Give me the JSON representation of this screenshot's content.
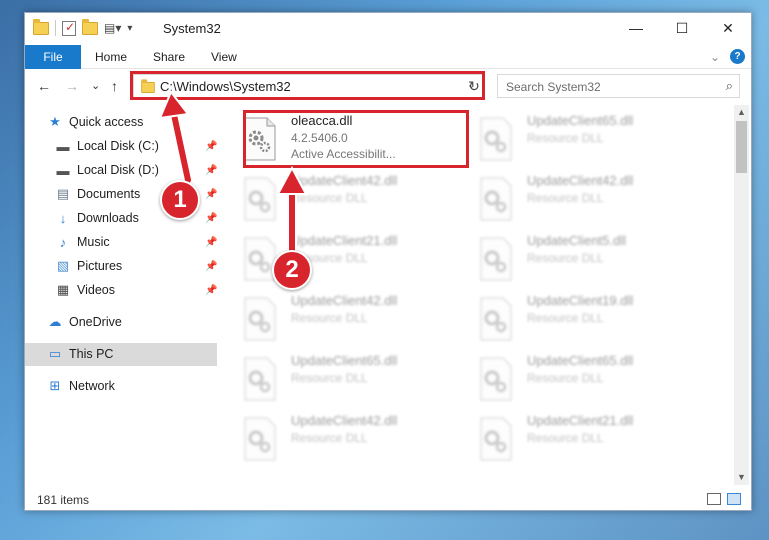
{
  "window": {
    "title": "System32",
    "controls": {
      "minimize": "—",
      "maximize": "☐",
      "close": "✕"
    }
  },
  "ribbon": {
    "tabs": [
      "File",
      "Home",
      "Share",
      "View"
    ],
    "collapse_glyph": "⌄",
    "help_glyph": "?"
  },
  "nav": {
    "back": "←",
    "forward": "→",
    "recent": "⌄",
    "up": "↑"
  },
  "address": {
    "path": "C:\\Windows\\System32",
    "dropdown": "⌄",
    "refresh": "↻"
  },
  "search": {
    "placeholder": "Search System32",
    "icon": "⌕"
  },
  "sidebar": {
    "items": [
      {
        "label": "Quick access",
        "icon": "★",
        "color": "#2d7fd3",
        "pinned": false
      },
      {
        "label": "Local Disk (C:)",
        "icon": "▬",
        "color": "#555555",
        "pinned": true
      },
      {
        "label": "Local Disk (D:)",
        "icon": "▬",
        "color": "#555555",
        "pinned": true
      },
      {
        "label": "Documents",
        "icon": "▤",
        "color": "#6a7a8a",
        "pinned": true
      },
      {
        "label": "Downloads",
        "icon": "↓",
        "color": "#2d7fd3",
        "pinned": true
      },
      {
        "label": "Music",
        "icon": "♪",
        "color": "#2d7fd3",
        "pinned": true
      },
      {
        "label": "Pictures",
        "icon": "▧",
        "color": "#4a8fcf",
        "pinned": true
      },
      {
        "label": "Videos",
        "icon": "▦",
        "color": "#444444",
        "pinned": true
      },
      {
        "label": "OneDrive",
        "icon": "☁",
        "color": "#2d7fd3",
        "pinned": false
      },
      {
        "label": "This PC",
        "icon": "▭",
        "color": "#2d7fd3",
        "pinned": false
      },
      {
        "label": "Network",
        "icon": "⊞",
        "color": "#2d7fd3",
        "pinned": false
      }
    ],
    "pin_glyph": "📌"
  },
  "files": [
    {
      "name": "oleacca.dll",
      "version": "4.2.5406.0",
      "description": "Active Accessibilit...",
      "highlighted": true
    },
    {
      "name": "UpdateClient65.dll",
      "type": "Resource DLL"
    },
    {
      "name": "UpdateClient42.dll",
      "type": "Resource DLL"
    },
    {
      "name": "UpdateClient42.dll",
      "type": "Resource DLL"
    },
    {
      "name": "UpdateClient21.dll",
      "type": "Resource DLL"
    },
    {
      "name": "UpdateClient5.dll",
      "type": "Resource DLL"
    },
    {
      "name": "UpdateClient42.dll",
      "type": "Resource DLL"
    },
    {
      "name": "UpdateClient19.dll",
      "type": "Resource DLL"
    },
    {
      "name": "UpdateClient65.dll",
      "type": "Resource DLL"
    },
    {
      "name": "UpdateClient65.dll",
      "type": "Resource DLL"
    },
    {
      "name": "UpdateClient42.dll",
      "type": "Resource DLL"
    },
    {
      "name": "UpdateClient21.dll",
      "type": "Resource DLL"
    }
  ],
  "status": {
    "item_count": "181 items"
  },
  "callouts": {
    "step1": "1",
    "step2": "2",
    "color": "#d8252d"
  }
}
